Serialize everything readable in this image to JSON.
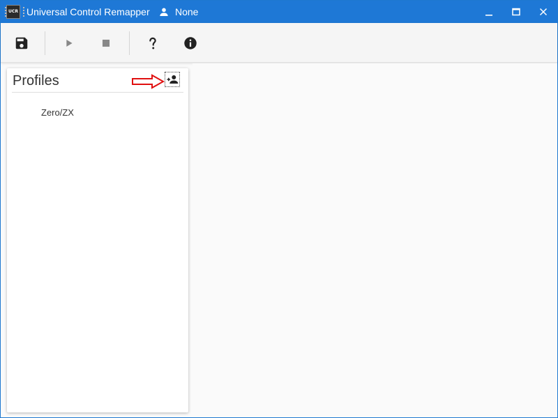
{
  "window": {
    "app_icon_text": "UCR",
    "title": "Universal Control Remapper",
    "active_profile": "None",
    "controls": {
      "minimize": "minimize-icon",
      "maximize": "maximize-icon",
      "close": "close-icon"
    }
  },
  "toolbar": {
    "buttons": [
      {
        "icon": "save-icon",
        "enabled": true
      },
      {
        "icon": "play-icon",
        "enabled": false
      },
      {
        "icon": "stop-icon",
        "enabled": false
      },
      {
        "icon": "help-icon",
        "enabled": true
      },
      {
        "icon": "info-icon",
        "enabled": true
      }
    ]
  },
  "profiles_panel": {
    "title": "Profiles",
    "add_button_icon": "add-person-icon",
    "items": [
      {
        "label": "Zero/ZX"
      }
    ]
  },
  "colors": {
    "titlebar": "#1e78d6",
    "annotation_arrow": "#e01010",
    "icon_enabled": "#222222",
    "icon_disabled": "#888888"
  }
}
